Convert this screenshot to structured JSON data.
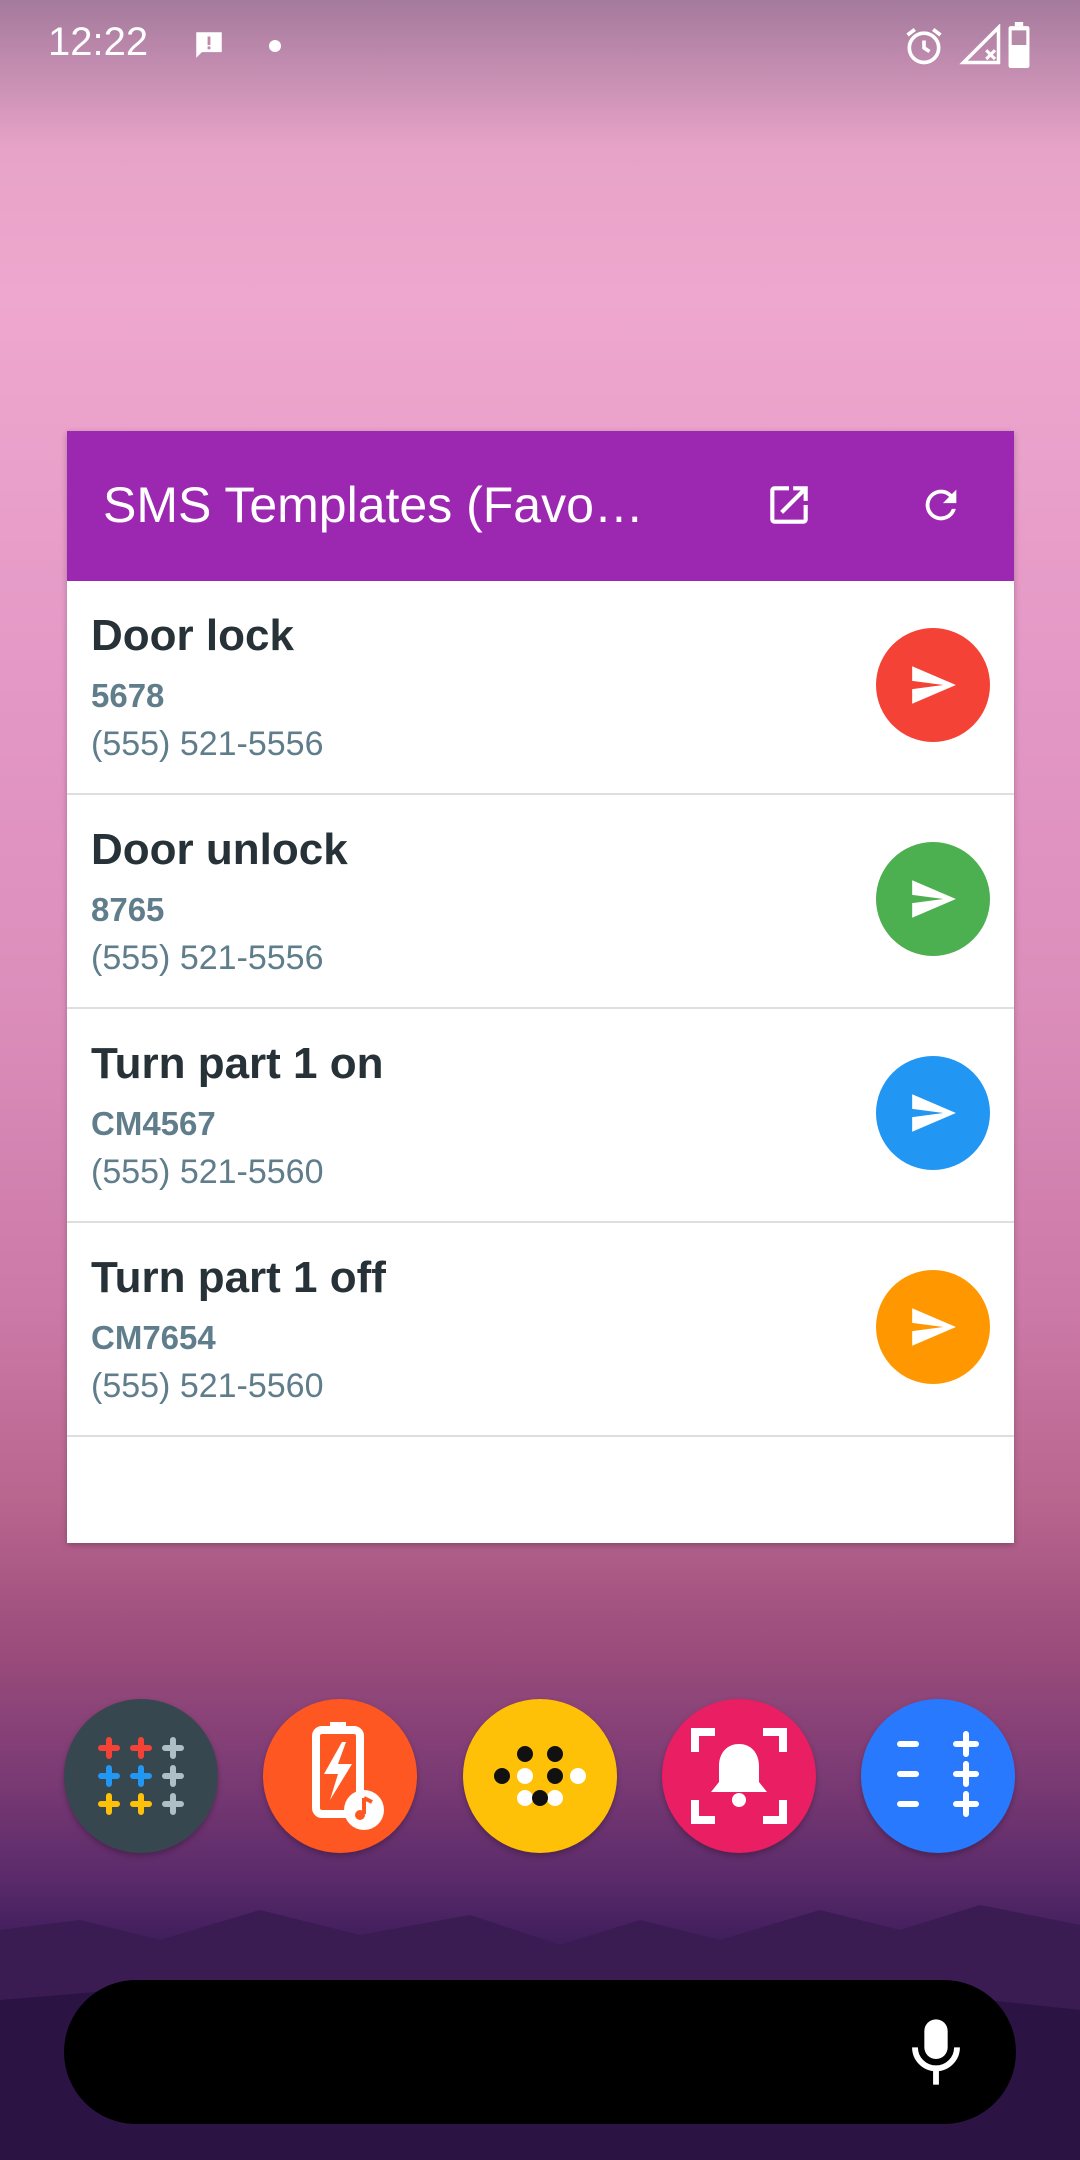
{
  "status_bar": {
    "time": "12:22",
    "icons": [
      "message-alert-icon",
      "notification-dot-icon",
      "alarm-icon",
      "signal-off-icon",
      "battery-icon"
    ]
  },
  "widget": {
    "title": "SMS Templates (Favo…",
    "header_icons": [
      "open-external-icon",
      "refresh-icon"
    ],
    "templates": [
      {
        "name": "Door lock",
        "body": "5678",
        "phone": "(555) 521-5556",
        "color": "#f44336"
      },
      {
        "name": "Door unlock",
        "body": "8765",
        "phone": "(555) 521-5556",
        "color": "#4caf50"
      },
      {
        "name": "Turn part 1 on",
        "body": "CM4567",
        "phone": "(555) 521-5560",
        "color": "#2196f3"
      },
      {
        "name": "Turn part 1 off",
        "body": "CM7654",
        "phone": "(555) 521-5560",
        "color": "#ff9800"
      }
    ],
    "header_color": "#9c27b0"
  },
  "dock": {
    "apps": [
      {
        "icon": "calculator-grid-icon",
        "color": "#37474f"
      },
      {
        "icon": "battery-sound-icon",
        "color": "#ff5722"
      },
      {
        "icon": "braille-dots-icon",
        "color": "#ffc107"
      },
      {
        "icon": "bell-frame-icon",
        "color": "#e91e63"
      },
      {
        "icon": "plus-minus-icon",
        "color": "#2979ff"
      }
    ]
  },
  "search_bar": {
    "icon": "microphone-icon"
  }
}
